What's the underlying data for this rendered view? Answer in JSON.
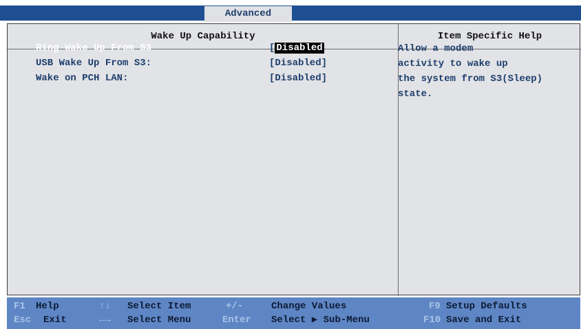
{
  "menubar": {
    "active_tab": "Advanced"
  },
  "panel": {
    "title": "Wake Up Capability",
    "help_title": "Item Specific Help"
  },
  "settings": [
    {
      "label": "Ring Wake Up From S3",
      "value": "Disabled",
      "selected": true
    },
    {
      "label": "USB Wake Up From S3:",
      "value": "[Disabled]",
      "selected": false
    },
    {
      "label": "Wake on PCH LAN:",
      "value": "[Disabled]",
      "selected": false
    }
  ],
  "help": {
    "lines": [
      "Allow a modem",
      "activity to wake up",
      "the system from S3(Sleep)",
      "state."
    ]
  },
  "keys": {
    "f1": {
      "key": "F1",
      "desc": "Help"
    },
    "updown": {
      "key": "↑↓",
      "desc": "Select Item"
    },
    "plusminus": {
      "key": "+/-",
      "desc": "Change Values"
    },
    "f9": {
      "key": "F9",
      "desc": "Setup Defaults"
    },
    "esc": {
      "key": "Esc",
      "desc": "Exit"
    },
    "leftright": {
      "key": "←→",
      "desc": "Select Menu"
    },
    "enter": {
      "key": "Enter",
      "desc": "Select ▶ Sub-Menu"
    },
    "f10": {
      "key": "F10",
      "desc": "Save and Exit"
    }
  },
  "colors": {
    "menubar": "#1e4f93",
    "panel_bg": "#e2e3e7",
    "text": "#1d3e6c",
    "keybar": "#5f86c4",
    "selection_bg": "#000000"
  }
}
